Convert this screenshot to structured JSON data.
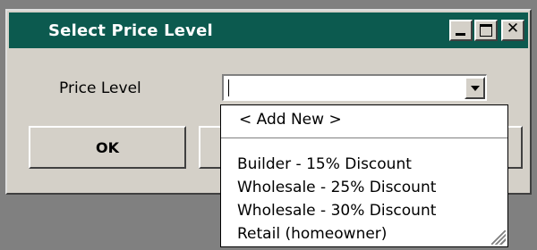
{
  "window": {
    "title": "Select Price Level",
    "controls": {
      "minimize_icon": "minimize-icon",
      "maximize_icon": "maximize-icon",
      "close_icon": "close-icon",
      "close_glyph": "✕"
    }
  },
  "form": {
    "price_level_label": "Price Level",
    "price_level_value": ""
  },
  "buttons": {
    "ok_label": "OK",
    "cancel_label": "",
    "extra_label": ""
  },
  "dropdown": {
    "add_new": "< Add New >",
    "options": [
      "Builder - 15% Discount",
      "Wholesale - 25% Discount",
      "Wholesale - 30% Discount",
      "Retail (homeowner)"
    ]
  },
  "colors": {
    "titlebar": "#0c5a4f",
    "face": "#d4d0c8",
    "desktop": "#808080"
  }
}
